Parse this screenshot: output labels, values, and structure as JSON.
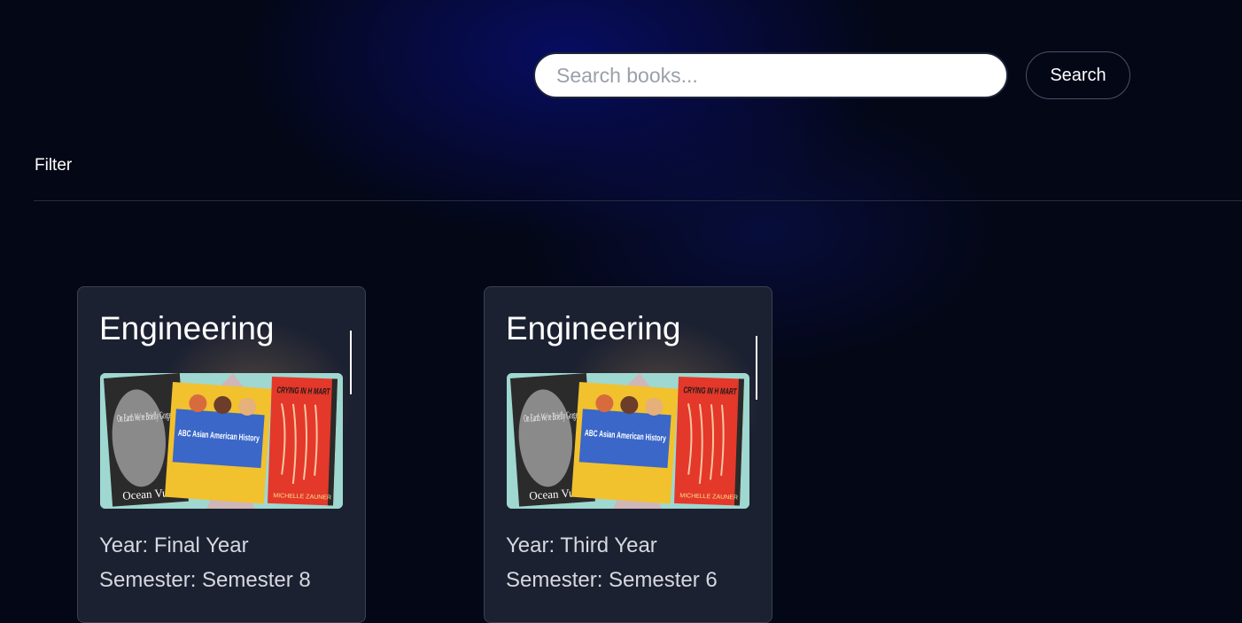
{
  "search": {
    "placeholder": "Search books...",
    "value": "",
    "button_label": "Search"
  },
  "filter": {
    "label": "Filter"
  },
  "cards": [
    {
      "title": "Engineering",
      "year": "Year: Final Year",
      "semester": "Semester: Semester 8",
      "cover": {
        "book1_title": "On Earth We're Briefly Gorgeous",
        "book1_author": "Ocean Vuong",
        "book2_title": "ABC Asian American History",
        "book3_title": "CRYING IN H MART",
        "book3_author": "MICHELLE ZAUNER"
      }
    },
    {
      "title": "Engineering",
      "year": "Year: Third Year",
      "semester": "Semester: Semester 6",
      "cover": {
        "book1_title": "On Earth We're Briefly Gorgeous",
        "book1_author": "Ocean Vuong",
        "book2_title": "ABC Asian American History",
        "book3_title": "CRYING IN H MART",
        "book3_author": "MICHELLE ZAUNER"
      }
    }
  ],
  "colors": {
    "background": "#040716",
    "card": "#1c2131",
    "accent_glow": "#0a0f6e"
  }
}
